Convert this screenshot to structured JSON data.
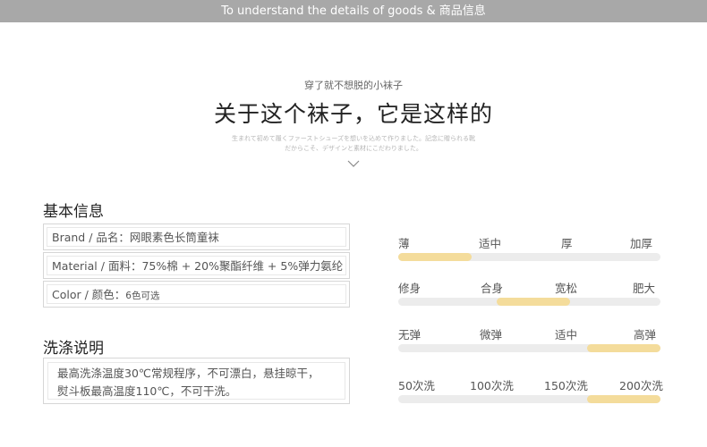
{
  "header": {
    "title": "To understand the details of goods & 商品信息"
  },
  "hero": {
    "subtitle": "穿了就不想脱的小袜子",
    "headline": "关于这个袜子，它是这样的",
    "tagline_1": "生まれて初めて履くファーストシューズを想いを込めて作りました。記念に贈られる靴",
    "tagline_2": "だからこそ、デザインと素材にこだわりました。",
    "icon": "chevron-down-icon"
  },
  "info": {
    "title": "基本信息",
    "rows": [
      {
        "label": "Brand / 品名：",
        "value": "网眼素色长筒童袜"
      },
      {
        "label": "Material / 面料：",
        "value": "75%棉 + 20%聚酯纤维 + 5%弹力氨纶"
      },
      {
        "label": "Color / 颜色：",
        "value": "6色可选"
      }
    ]
  },
  "wash": {
    "title": "洗涤说明",
    "line1": "最高洗涤温度30℃常规程序，不可漂白，悬挂晾干，",
    "line2": "熨斗板最高温度110℃，不可干洗。"
  },
  "scales": [
    {
      "labels": [
        "薄",
        "适中",
        "厚",
        "加厚"
      ],
      "selected": "薄",
      "level": 0.28
    },
    {
      "labels": [
        "修身",
        "合身",
        "宽松",
        "肥大"
      ],
      "selected": "合身",
      "level": 0.5
    },
    {
      "labels": [
        "无弹",
        "微弹",
        "适中",
        "高弹"
      ],
      "selected": "高弹",
      "level": 1.0
    },
    {
      "labels": [
        "50次洗",
        "100次洗",
        "150次洗",
        "200次洗"
      ],
      "selected": "200次洗",
      "level": 1.0
    }
  ],
  "colors": {
    "topbar": "#a8a8a8",
    "scale_fill": "#f4dc9b",
    "scale_track": "#ececec"
  }
}
